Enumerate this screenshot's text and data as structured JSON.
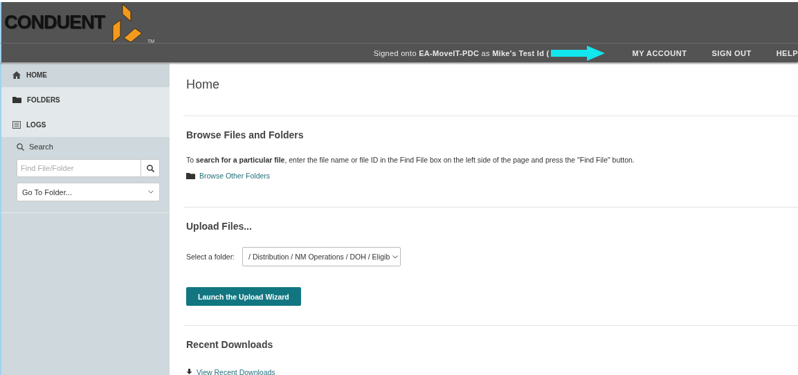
{
  "header": {
    "logo_text": "CONDUENT",
    "logo_mark": "TM"
  },
  "topbar": {
    "signed_on": "Signed onto **EA-MoveIT-PDC** as **Mike's Test Id (**",
    "links": [
      "MY ACCOUNT",
      "SIGN OUT",
      "HELP"
    ]
  },
  "sidebar": {
    "items": [
      {
        "label": "HOME",
        "selected": true
      },
      {
        "label": "FOLDERS",
        "selected": false
      },
      {
        "label": "LOGS",
        "selected": false
      }
    ],
    "search": {
      "title": "Search",
      "placeholder": "Find File/Folder",
      "goto": "Go To Folder..."
    }
  },
  "main": {
    "title": "Home",
    "sections": [
      {
        "kind": "browse",
        "heading": "Browse Files and Folders",
        "text": "To **search for a particular file**, enter the file name or file ID in the Find File box on the left side of the page and press the \"Find File\" button.",
        "link": "Browse Other Folders"
      },
      {
        "kind": "upload",
        "heading": "Upload Files...",
        "label": "Select a folder:",
        "folder": "/ Distribution / NM Operations / DOH / Eligib",
        "button": "Launch the Upload Wizard"
      },
      {
        "kind": "downloads",
        "heading": "Recent Downloads",
        "link": "View Recent Downloads"
      }
    ]
  }
}
